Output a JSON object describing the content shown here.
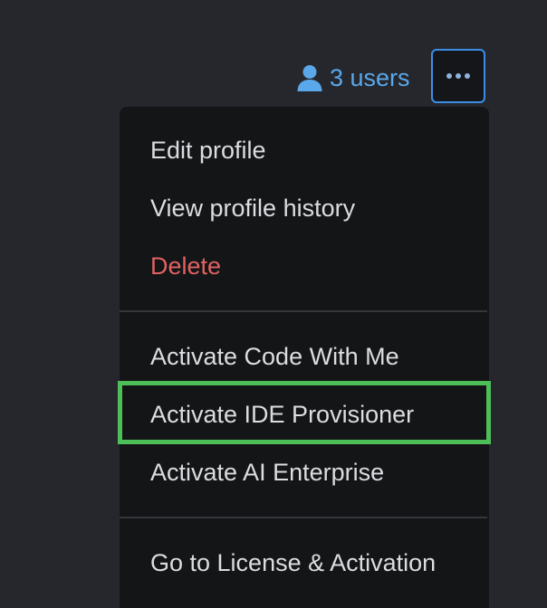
{
  "header": {
    "users_label": "3 users",
    "users_icon": "user-icon",
    "more_icon": "ellipsis-icon"
  },
  "menu": {
    "items": [
      {
        "label": "Edit profile"
      },
      {
        "label": "View profile history"
      },
      {
        "label": "Delete",
        "style": "danger"
      },
      {
        "label": "Activate Code With Me"
      },
      {
        "label": "Activate IDE Provisioner",
        "highlighted": true
      },
      {
        "label": "Activate AI Enterprise"
      },
      {
        "label": "Go to License & Activation"
      }
    ]
  },
  "colors": {
    "background": "#25272c",
    "menu_background": "#131517",
    "link": "#5aa7ea",
    "danger": "#e06262",
    "highlight": "#4dbe58",
    "button_border": "#3b8ee8"
  }
}
